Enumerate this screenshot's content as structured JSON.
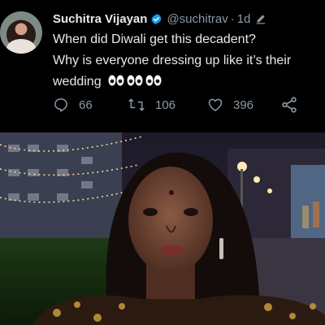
{
  "tweet": {
    "author_name": "Suchitra Vijayan",
    "handle": "@suchitrav",
    "separator": "·",
    "time": "1d",
    "text_line1": "When did Diwali get this decadent?",
    "text_line2": "Why is everyone dressing up like it’s their",
    "text_line3": "wedding",
    "emoji": "eyes-emoji",
    "emoji_count": 3,
    "verified_color": "#1d9bf0",
    "actions": {
      "replies": "66",
      "retweets": "106",
      "likes": "396"
    }
  },
  "icons": {
    "avatar": "profile-photo",
    "verified": "verified-badge-icon",
    "edit": "edit-pencil-icon",
    "reply": "reply-icon",
    "retweet": "retweet-icon",
    "like": "heart-icon",
    "share": "share-icon"
  },
  "media": {
    "type": "video-still",
    "subject": "selfie-woman-night-lights"
  }
}
